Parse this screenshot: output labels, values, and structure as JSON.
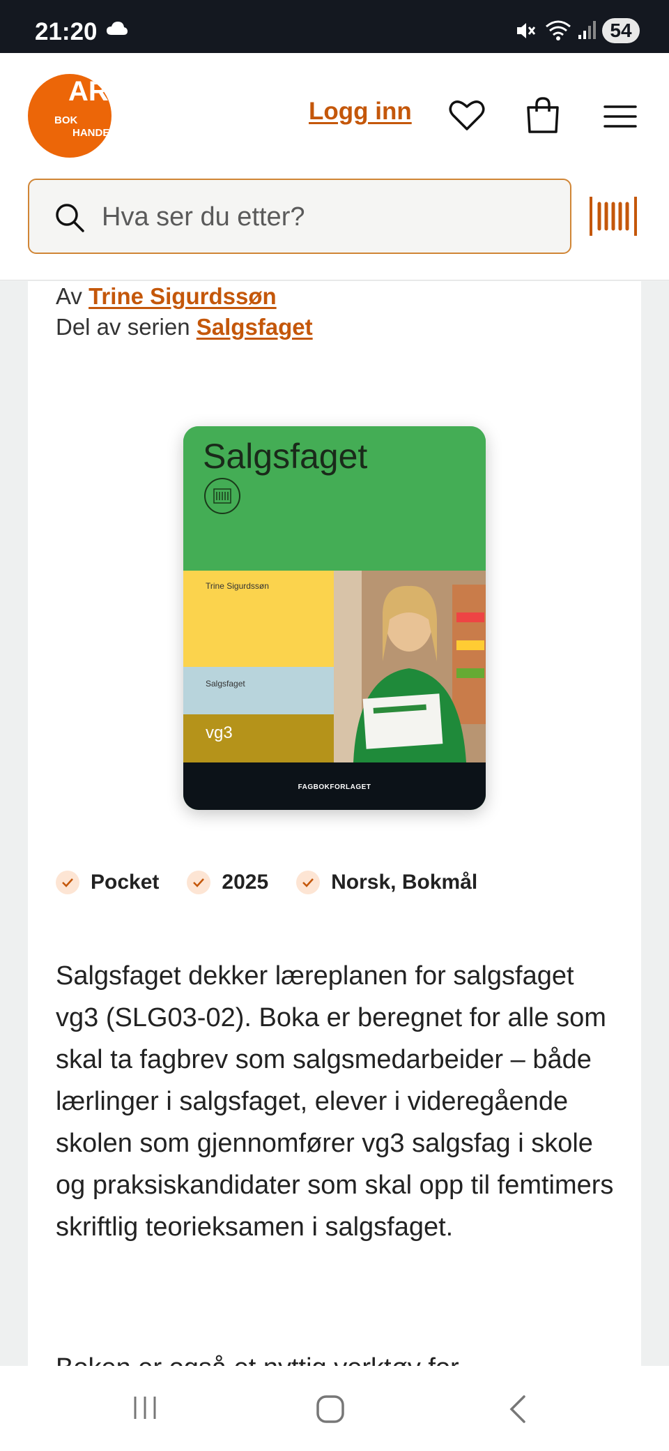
{
  "status_bar": {
    "time": "21:20",
    "battery": "54",
    "icons": [
      "cloud-icon",
      "mute-icon",
      "wifi-icon",
      "signal-icon"
    ]
  },
  "header": {
    "logo": {
      "line1": "ARK",
      "line2": "BOK",
      "line3": "HANDEL"
    },
    "login_label": "Logg inn",
    "search_placeholder": "Hva ser du etter?",
    "brand_color": "#ec6608",
    "accent_color": "#c4570a"
  },
  "product": {
    "by_prefix": "Av",
    "author": "Trine Sigurdssøn",
    "series_prefix": "Del av serien",
    "series": "Salgsfaget",
    "cover": {
      "title": "Salgsfaget",
      "author": "Trine Sigurdssøn",
      "series": "Salgsfaget",
      "level": "vg3",
      "publisher": "FAGBOKFORLAGET"
    },
    "tags": [
      "Pocket",
      "2025",
      "Norsk, Bokmål"
    ],
    "description": "Salgsfaget dekker læreplanen for salgsfaget vg3 (SLG03-02). Boka er beregnet for alle som skal ta fagbrev som salgsmedarbeider – både lærlinger i salgsfaget, elever i videregående skolen som gjennomfører vg3 salgsfag i skole og praksiskandidater som skal opp til femtimers skriftlig teorieksamen i salgsfaget.",
    "description_next": "Boken er også et nyttig verktøy for"
  },
  "nav_bar": {
    "icons": [
      "recent-apps-icon",
      "home-icon",
      "back-icon"
    ]
  }
}
